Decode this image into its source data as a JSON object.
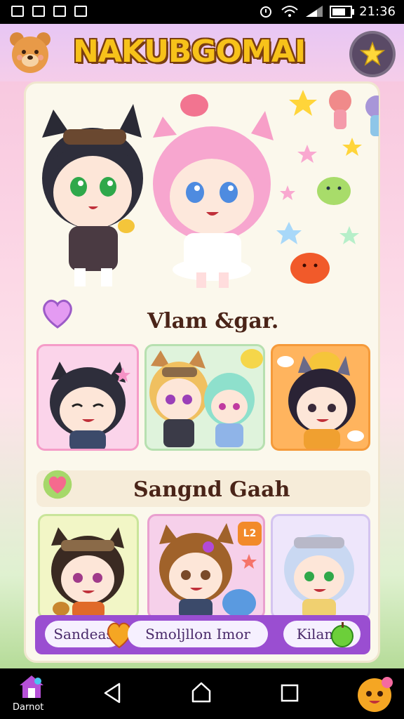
{
  "status_bar": {
    "time": "21:36",
    "icons": [
      "screenshot-icon",
      "app-icon",
      "notif-icon",
      "media-icon",
      "alarm-icon",
      "wifi-icon",
      "signal-icon",
      "battery-icon"
    ]
  },
  "header": {
    "title": "NAKUBGOMAI",
    "left_icon": "bear-avatar-icon",
    "right_icon": "star-icon"
  },
  "sections": [
    {
      "title": "Vlam &gar.",
      "icon": "heart-icon"
    },
    {
      "title": "Sangnd Gaah",
      "icon": "heart-icon"
    }
  ],
  "tiles_row1": [
    {
      "name": "black-cat-girl-tile",
      "bg": "#fbd4ea"
    },
    {
      "name": "duo-bear-tile",
      "bg": "#dff3dc"
    },
    {
      "name": "orange-cat-tile",
      "bg": "#ffb45e"
    }
  ],
  "tiles_row2": [
    {
      "name": "brown-bear-girl-tile",
      "bg": "#f2f6c6",
      "badge": ""
    },
    {
      "name": "brown-fox-girl-tile",
      "bg": "#f6d0ea",
      "badge": "L2"
    },
    {
      "name": "white-hair-boy-tile",
      "bg": "#eee6fb",
      "badge": ""
    }
  ],
  "bottom_bar": {
    "left_pill": "Sandeas",
    "center_pill": "Smoljllon Imor",
    "right_pill": "Kilan"
  },
  "nav_bar": {
    "home_label": "Darnot"
  },
  "colors": {
    "accent": "#9a4ed1",
    "title_fill": "#f7c21a",
    "title_outline": "#7a3e10",
    "heading_text": "#4a2418"
  }
}
